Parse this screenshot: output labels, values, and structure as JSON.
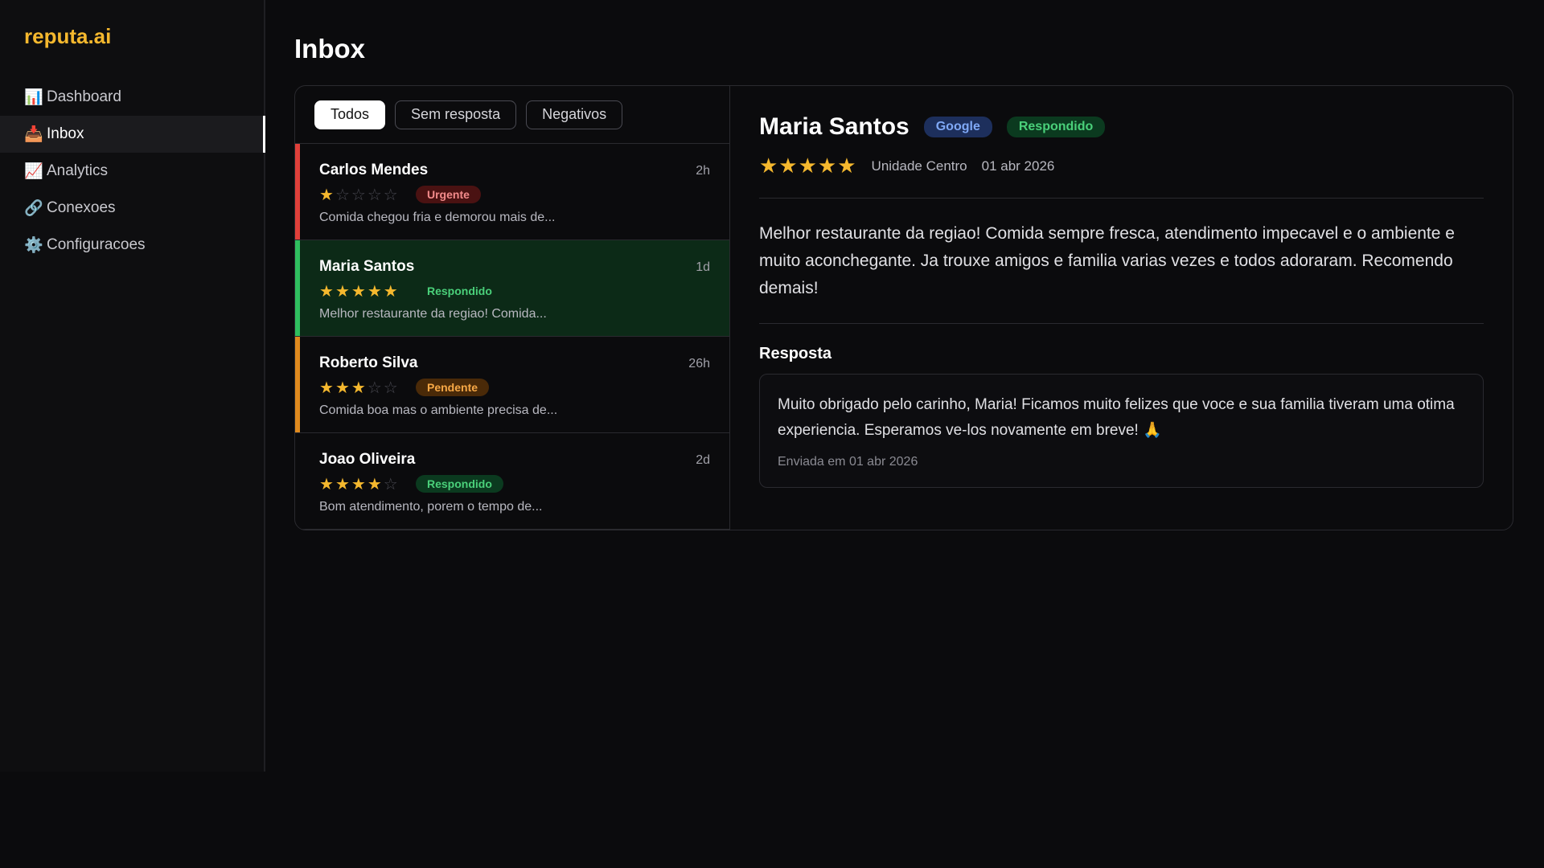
{
  "brand": {
    "name": "reputa.ai",
    "accent": "#f5b82e"
  },
  "sidebar": {
    "items": [
      {
        "icon": "📊",
        "icon_name": "bar-chart-icon",
        "label": "Dashboard"
      },
      {
        "icon": "📥",
        "icon_name": "inbox-tray-icon",
        "label": "Inbox",
        "active": true
      },
      {
        "icon": "📈",
        "icon_name": "trend-chart-icon",
        "label": "Analytics"
      },
      {
        "icon": "🔗",
        "icon_name": "link-icon",
        "label": "Conexoes"
      },
      {
        "icon": "⚙️",
        "icon_name": "gear-icon",
        "label": "Configuracoes"
      }
    ]
  },
  "page": {
    "title": "Inbox"
  },
  "filters": {
    "tabs": [
      "Todos",
      "Sem resposta",
      "Negativos"
    ],
    "active": "Todos"
  },
  "reviews": [
    {
      "name": "Carlos Mendes",
      "time": "2h",
      "rating": 1,
      "badge": "Urgente",
      "badge_style": "red",
      "preview": "Comida chegou fria e demorou mais de...",
      "bar_color": "#e0403a"
    },
    {
      "name": "Maria Santos",
      "time": "1d",
      "rating": 5,
      "badge": "Respondido",
      "badge_style": "plain",
      "preview": "Melhor restaurante da regiao! Comida...",
      "bar_color": "#2fbf5e",
      "selected": true
    },
    {
      "name": "Roberto Silva",
      "time": "26h",
      "rating": 3,
      "badge": "Pendente",
      "badge_style": "orange",
      "preview": "Comida boa mas o ambiente precisa de...",
      "bar_color": "#e08a1e"
    },
    {
      "name": "Joao Oliveira",
      "time": "2d",
      "rating": 4,
      "badge": "Respondido",
      "badge_style": "green",
      "preview": "Bom atendimento, porem o tempo de...",
      "bar_color": ""
    }
  ],
  "detail": {
    "name": "Maria Santos",
    "source": "Google",
    "status": "Respondido",
    "stars": "★★★★★",
    "location": "Unidade Centro",
    "date": "01 abr 2026",
    "text": "Melhor restaurante da regiao! Comida sempre fresca, atendimento impecavel e o ambiente e muito aconchegante. Ja trouxe amigos e familia varias vezes e todos adoraram. Recomendo demais!",
    "response_title": "Resposta",
    "response_text": "Muito obrigado pelo carinho, Maria! Ficamos muito felizes que voce e sua familia tiveram uma otima experiencia. Esperamos ve-los novamente em breve! 🙏",
    "response_sent": "Enviada em 01 abr 2026"
  }
}
